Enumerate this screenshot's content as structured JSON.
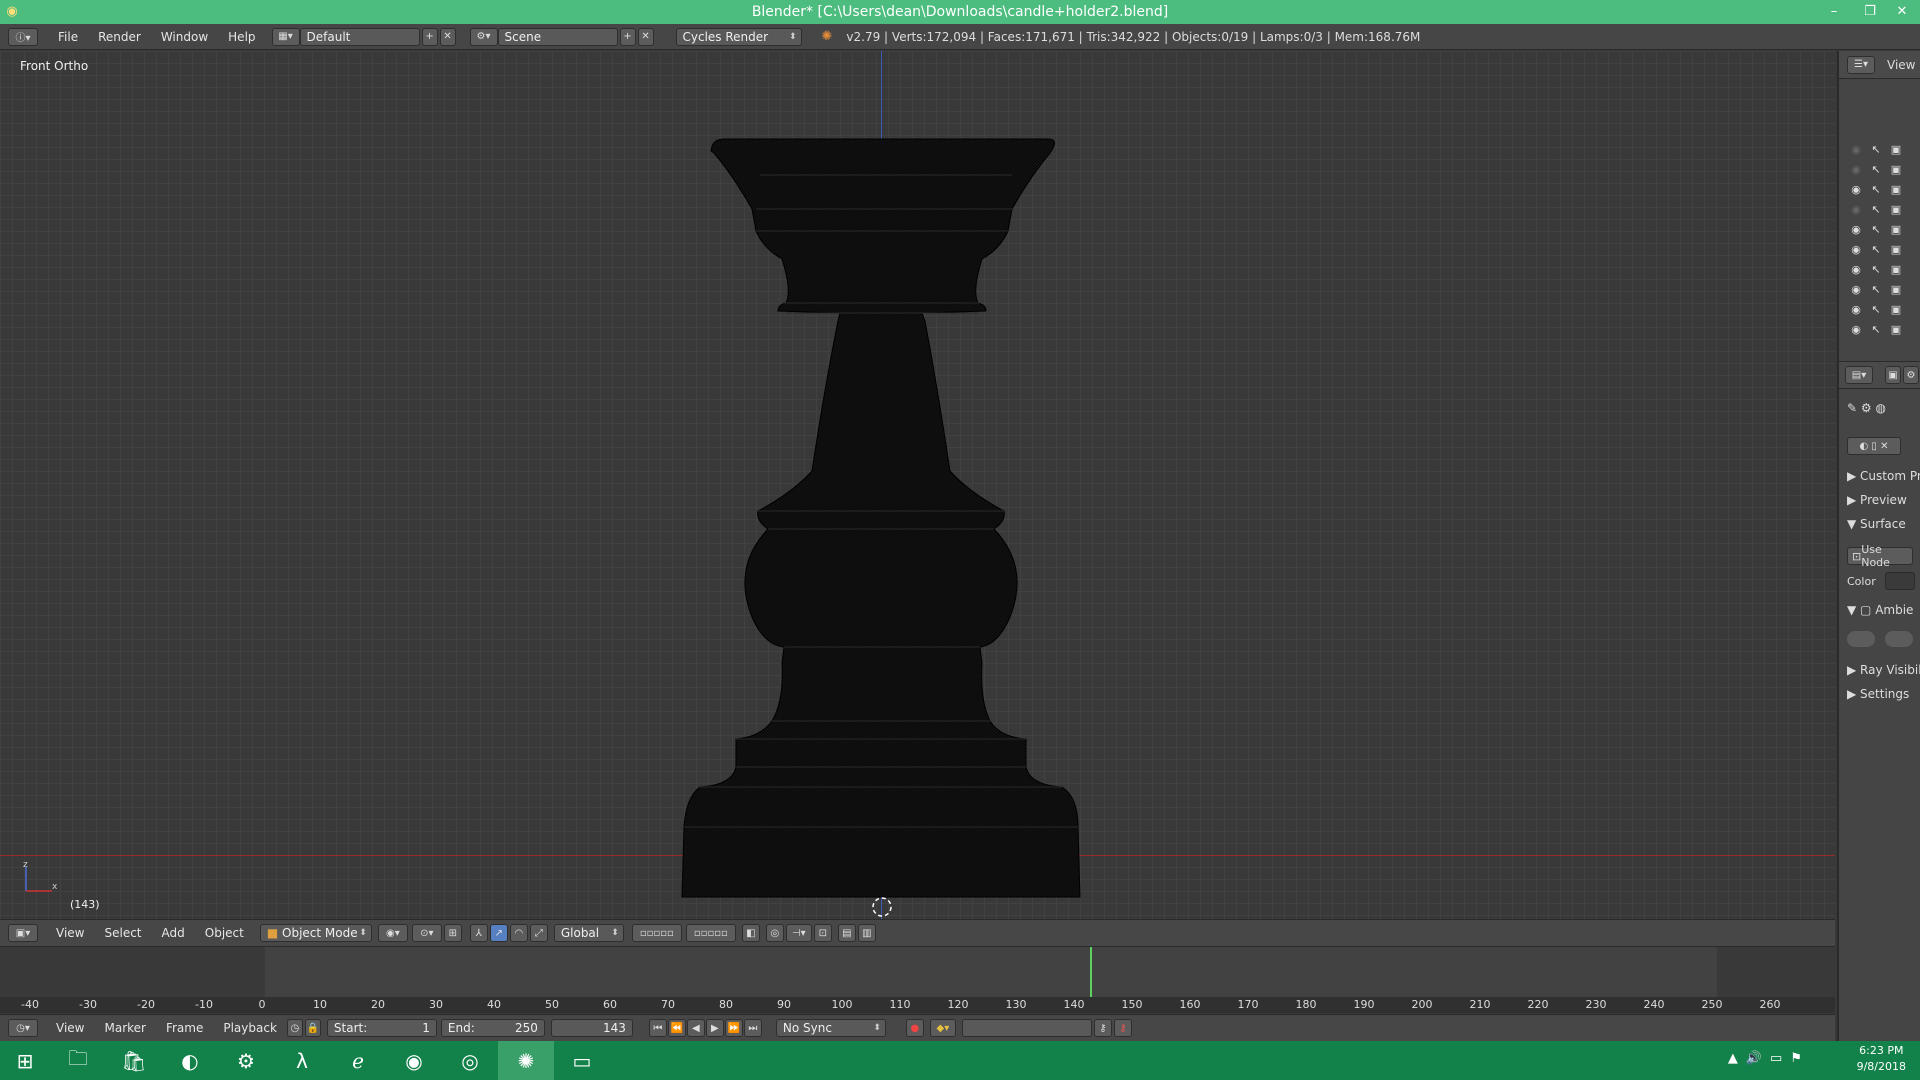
{
  "window": {
    "title": "Blender* [C:\\Users\\dean\\Downloads\\candle+holder2.blend]",
    "minimize": "–",
    "maximize": "❐",
    "close": "✕"
  },
  "info_header": {
    "menus": [
      "File",
      "Render",
      "Window",
      "Help"
    ],
    "layout": "Default",
    "scene": "Scene",
    "engine": "Cycles Render",
    "stats": "v2.79 | Verts:172,094 | Faces:171,671 | Tris:342,922 | Objects:0/19 | Lamps:0/3 | Mem:168.76M"
  },
  "viewport": {
    "view_label": "Front Ortho",
    "frame_label": "(143)",
    "axis_z": "z",
    "axis_x": "x"
  },
  "view3d_header": {
    "menus": [
      "View",
      "Select",
      "Add",
      "Object"
    ],
    "mode": "Object Mode",
    "orientation": "Global"
  },
  "timeline": {
    "ticks": [
      "-40",
      "-30",
      "-20",
      "-10",
      "0",
      "10",
      "20",
      "30",
      "40",
      "50",
      "60",
      "70",
      "80",
      "90",
      "100",
      "110",
      "120",
      "130",
      "140",
      "150",
      "160",
      "170",
      "180",
      "190",
      "200",
      "210",
      "220",
      "230",
      "240",
      "250",
      "260"
    ],
    "current_frame": 143
  },
  "timeline_header": {
    "menus": [
      "View",
      "Marker",
      "Frame",
      "Playback"
    ],
    "start_label": "Start:",
    "start_value": "1",
    "end_label": "End:",
    "end_value": "250",
    "current": "143",
    "sync": "No Sync"
  },
  "outliner": {
    "header_label": "View"
  },
  "properties": {
    "panels": [
      "Custom Pr",
      "Preview",
      "Surface",
      "Use Node",
      "Color",
      "Ambie",
      "Ray Visibil",
      "Settings"
    ]
  },
  "taskbar": {
    "time": "6:23 PM",
    "date": "9/8/2018"
  }
}
